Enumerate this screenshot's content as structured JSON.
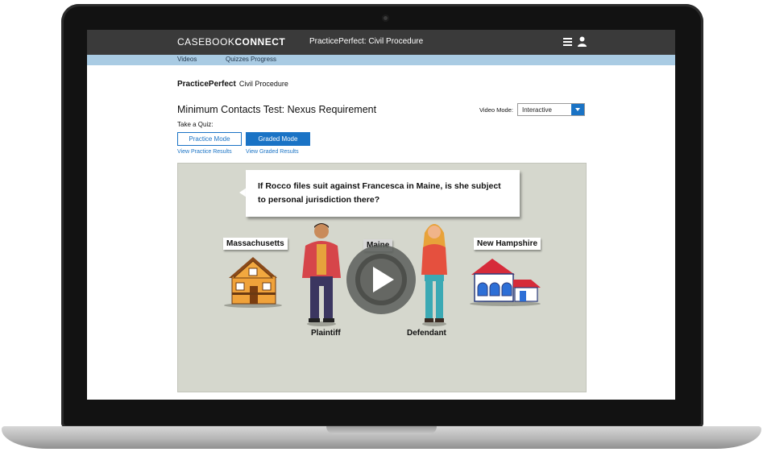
{
  "app": {
    "brand_primary": "CASEBOOK",
    "brand_secondary": "CONNECT",
    "title": "PracticePerfect: Civil Procedure"
  },
  "subnav": {
    "items": [
      "Videos",
      "Quizzes",
      "Progress"
    ]
  },
  "product": {
    "name": "PracticePerfect",
    "course": "Civil Procedure"
  },
  "lesson": {
    "title": "Minimum Contacts Test: Nexus Requirement"
  },
  "video_mode": {
    "label": "Video Mode:",
    "selected": "Interactive"
  },
  "quiz": {
    "label": "Take a Quiz:",
    "practice_button": "Practice Mode",
    "graded_button": "Graded Mode",
    "practice_results_link": "View Practice Results",
    "graded_results_link": "View Graded Results"
  },
  "video": {
    "question": "If Rocco files suit against Francesca in Maine, is she subject to personal jurisdiction there?",
    "left_state": "Massachusetts",
    "center_state": "Maine",
    "right_state": "New Hampshire",
    "plaintiff_label": "Plaintiff",
    "defendant_label": "Defendant",
    "play_icon": "play-icon"
  },
  "colors": {
    "header_bg": "#3a3a3a",
    "subnav_bg": "#a9cbe3",
    "accent": "#1a73c5",
    "video_bg": "#d5d7cd"
  }
}
